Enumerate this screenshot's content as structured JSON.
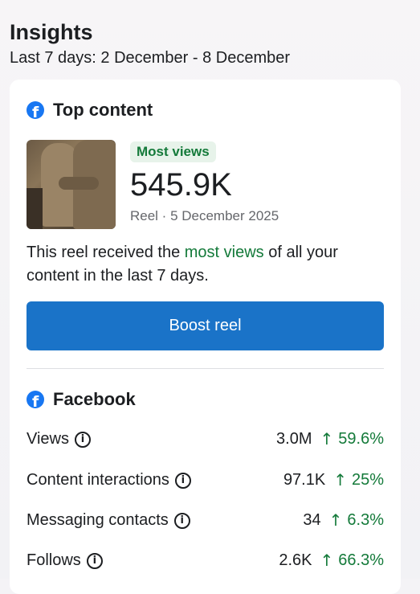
{
  "header": {
    "title": "Insights",
    "subtitle": "Last 7 days: 2 December - 8 December"
  },
  "top_content": {
    "title": "Top content",
    "badge": "Most views",
    "views": "545.9K",
    "meta": "Reel · 5 December 2025",
    "desc_before": "This reel received the ",
    "desc_highlight": "most views",
    "desc_after": " of all your content in the last 7 days.",
    "boost_label": "Boost reel"
  },
  "facebook": {
    "title": "Facebook",
    "metrics": [
      {
        "label": "Views",
        "value": "3.0M",
        "change": "59.6%"
      },
      {
        "label": "Content interactions",
        "value": "97.1K",
        "change": "25%"
      },
      {
        "label": "Messaging contacts",
        "value": "34",
        "change": "6.3%"
      },
      {
        "label": "Follows",
        "value": "2.6K",
        "change": "66.3%"
      }
    ]
  },
  "colors": {
    "accent_blue": "#1a73c8",
    "facebook_blue": "#1877f2",
    "positive_green": "#147a3a"
  },
  "icons": {
    "facebook": "facebook-icon",
    "info": "info-icon",
    "trend_up": "arrow-up-icon"
  }
}
